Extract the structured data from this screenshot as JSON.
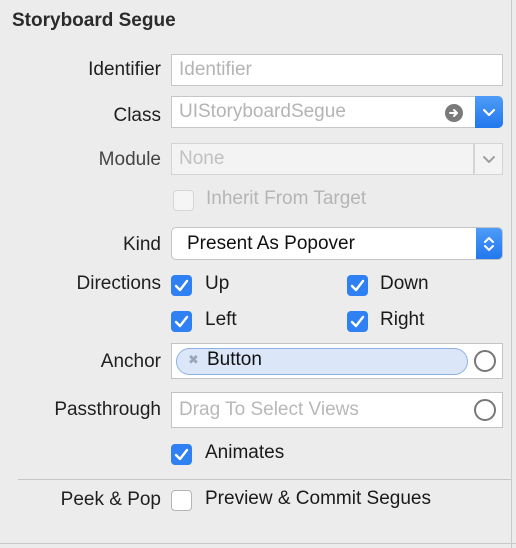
{
  "section": {
    "title": "Storyboard Segue"
  },
  "identifier": {
    "label": "Identifier",
    "placeholder": "Identifier"
  },
  "class": {
    "label": "Class",
    "placeholder": "UIStoryboardSegue"
  },
  "module": {
    "label": "Module",
    "placeholder": "None",
    "inherit_label": "Inherit From Target",
    "inherit_checked": false
  },
  "kind": {
    "label": "Kind",
    "value": "Present As Popover"
  },
  "directions": {
    "label": "Directions",
    "options": [
      {
        "label": "Up",
        "checked": true
      },
      {
        "label": "Down",
        "checked": true
      },
      {
        "label": "Left",
        "checked": true
      },
      {
        "label": "Right",
        "checked": true
      }
    ]
  },
  "anchor": {
    "label": "Anchor",
    "token": "Button"
  },
  "passthrough": {
    "label": "Passthrough",
    "placeholder": "Drag To Select Views"
  },
  "animates": {
    "label": "Animates",
    "checked": true
  },
  "peek_pop": {
    "label": "Peek & Pop",
    "option_label": "Preview & Commit Segues",
    "checked": false
  },
  "colors": {
    "accent": "#2f80f3",
    "background": "#ececec"
  },
  "icons": {
    "class_go": "arrow-right-circle-icon",
    "class_dropdown": "chevron-down-icon",
    "kind_stepper": "up-down-chevron-icon",
    "token_remove": "remove-x-icon",
    "target": "target-circle-icon"
  }
}
